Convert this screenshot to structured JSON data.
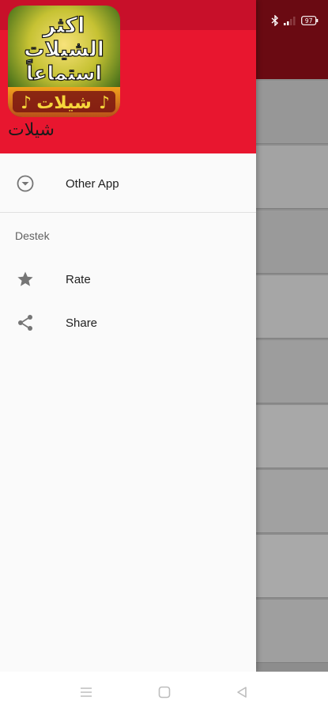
{
  "drawer": {
    "app_name": "شيلات",
    "app_icon_text": {
      "line1": "اكثر",
      "line2": "الشيلات",
      "line3": "استماعاً",
      "banner": "شيلات"
    },
    "items": [
      {
        "label": "Other App",
        "icon": "chevron-circle-down-icon"
      }
    ],
    "section": {
      "title": "Destek",
      "items": [
        {
          "label": "Rate",
          "icon": "star-icon"
        },
        {
          "label": "Share",
          "icon": "share-icon"
        }
      ]
    }
  },
  "status_bar": {
    "battery": "97"
  },
  "colors": {
    "header": "#e8162f",
    "header_top": "#c8102a",
    "toolbar_dimmed": "#6a0a12"
  }
}
